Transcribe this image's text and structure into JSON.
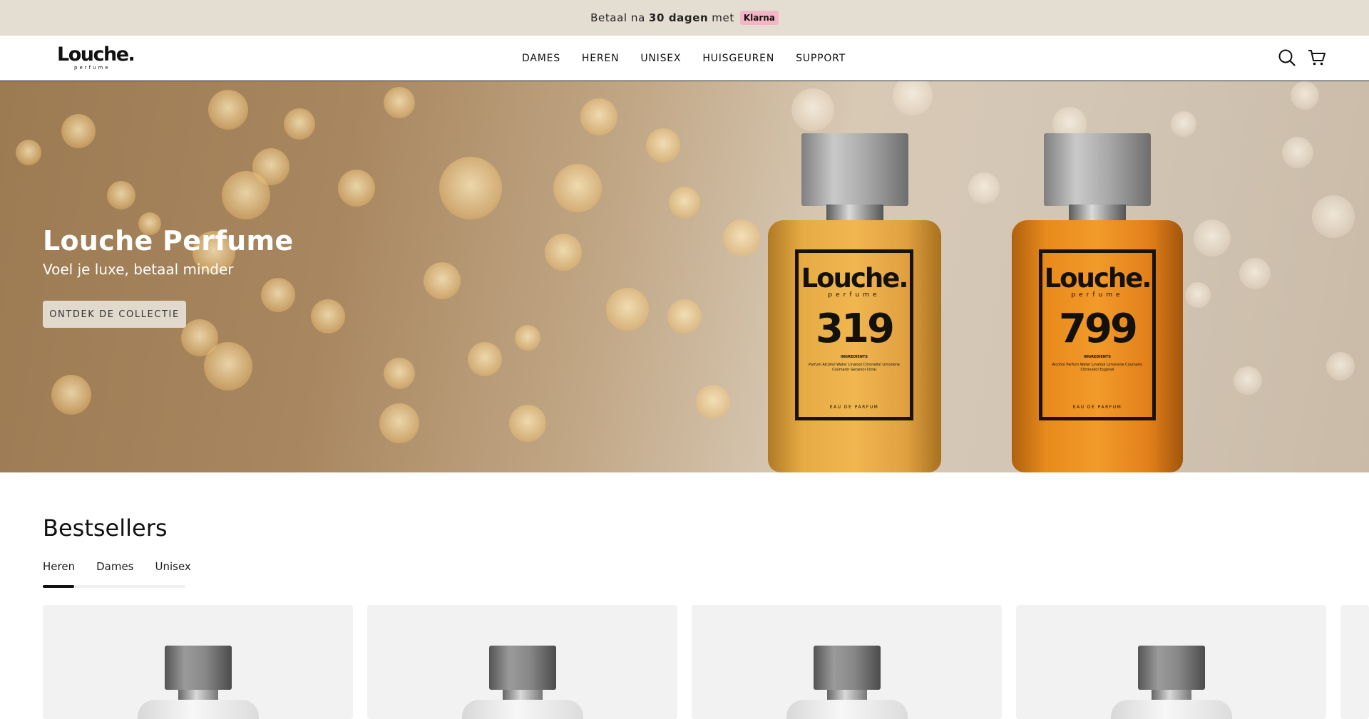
{
  "announcement": {
    "prefix": "Betaal na",
    "bold": "30 dagen",
    "suffix": "met",
    "badge": "Klarna"
  },
  "header": {
    "logo_text": "Louche.",
    "logo_sub": "perfume",
    "nav": [
      "DAMES",
      "HEREN",
      "UNISEX",
      "HUISGEUREN",
      "SUPPORT"
    ],
    "icons": [
      "search-icon",
      "cart-icon"
    ]
  },
  "hero": {
    "title": "Louche Perfume",
    "subtitle": "Voel je luxe, betaal minder",
    "button": "ONTDEK DE COLLECTIE",
    "bottles": [
      {
        "brand": "Louche.",
        "sub": "perfume",
        "number": "319",
        "ingredients_heading": "INGREDIENTS",
        "ingredients": "Parfum Alcohol Water Linalool Citronellol Limonene Coumarin Geraniol Citral",
        "edp": "EAU DE PARFUM",
        "color": "#e3a23a"
      },
      {
        "brand": "Louche.",
        "sub": "perfume",
        "number": "799",
        "ingredients_heading": "INGREDIENTS",
        "ingredients": "Alcohol Parfum Water Linalool Limonene Coumarin Citronellol Eugenol",
        "edp": "EAU DE PARFUM",
        "color": "#e68412"
      }
    ]
  },
  "bestsellers": {
    "title": "Bestsellers",
    "tabs": [
      "Heren",
      "Dames",
      "Unisex"
    ],
    "active_tab": "Heren"
  },
  "colors": {
    "announcement_bg": "#e4ddd1",
    "button_bg": "#e2d9cd",
    "card_bg": "#f2f2f2",
    "klarna_pink": "#f4b6c7"
  }
}
